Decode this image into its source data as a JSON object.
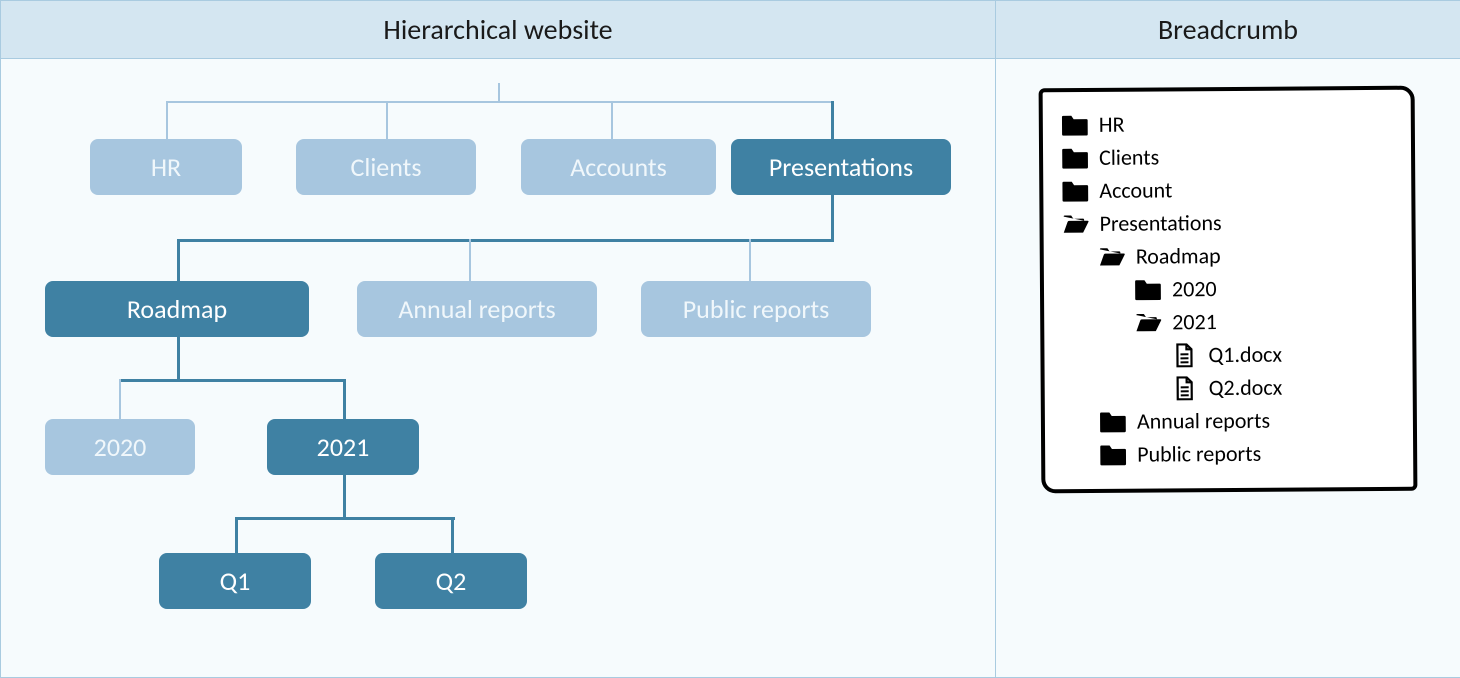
{
  "left": {
    "title": "Hierarchical website",
    "level1": {
      "hr": "HR",
      "clients": "Clients",
      "accounts": "Accounts",
      "presentations": "Presentations"
    },
    "level2": {
      "roadmap": "Roadmap",
      "annual": "Annual reports",
      "public": "Public reports"
    },
    "level3": {
      "y2020": "2020",
      "y2021": "2021"
    },
    "level4": {
      "q1": "Q1",
      "q2": "Q2"
    }
  },
  "right": {
    "title": "Breadcrumb",
    "items": {
      "hr": "HR",
      "clients": "Clients",
      "account": "Account",
      "presentations": "Presentations",
      "roadmap": "Roadmap",
      "y2020": "2020",
      "y2021": "2021",
      "q1": "Q1.docx",
      "q2": "Q2.docx",
      "annual": "Annual reports",
      "public": "Public reports"
    }
  }
}
